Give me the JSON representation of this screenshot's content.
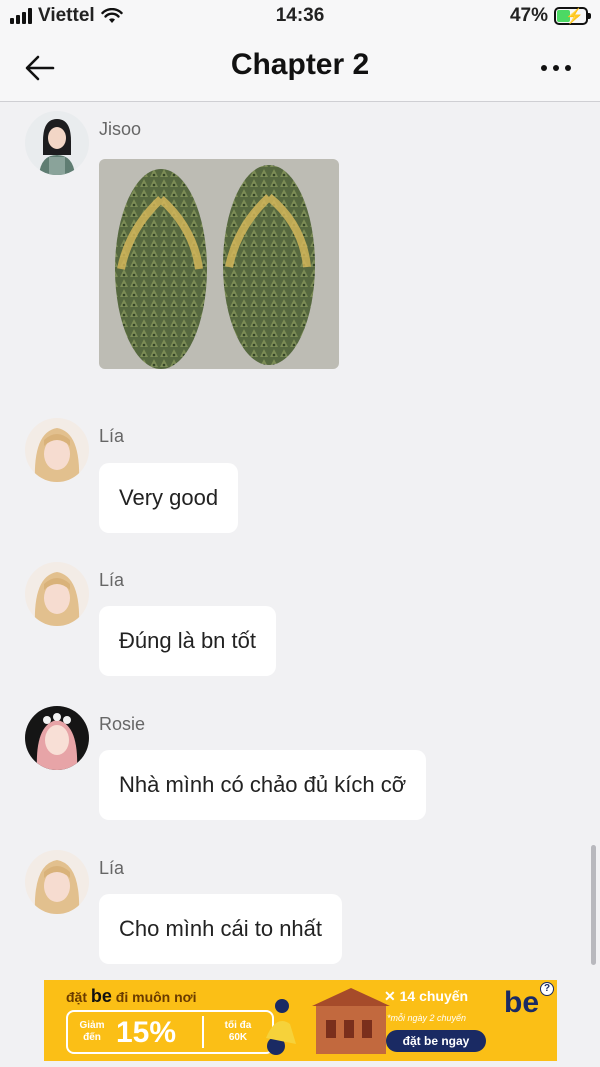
{
  "status_bar": {
    "carrier": "Viettel",
    "time": "14:36",
    "battery_percent_label": "47%",
    "battery_level": 0.47,
    "icons": [
      "signal-icon",
      "wifi-icon",
      "battery-charging-icon"
    ]
  },
  "nav": {
    "title": "Chapter 2",
    "icons": [
      "back-arrow-icon",
      "more-dots-icon"
    ]
  },
  "messages": [
    {
      "sender": "Jisoo",
      "type": "image",
      "image_subject": "durian-shell flip-flops"
    },
    {
      "sender": "Lía",
      "type": "text",
      "text": "Very good"
    },
    {
      "sender": "Lía",
      "type": "text",
      "text": "Đúng là bn tốt"
    },
    {
      "sender": "Rosie",
      "type": "text",
      "text": "Nhà mình có chảo đủ kích cỡ"
    },
    {
      "sender": "Lía",
      "type": "text",
      "text": "Cho mình cái to nhất"
    }
  ],
  "ad": {
    "headline_pre": "đặt",
    "headline_brand": "be",
    "headline_post": "đi muôn nơi",
    "promo_prefix_line1": "Giảm",
    "promo_prefix_line2": "đến",
    "promo_percent": "15%",
    "promo_suffix_line1": "tối đa",
    "promo_suffix_line2": "60K",
    "trips": "14 chuyến",
    "trips_note": "*mỗi ngày 2 chuyến",
    "cta": "đặt be ngay",
    "logo": "be",
    "help_icon": "?",
    "accent": "#fbbf16",
    "brand_color": "#1a2a63"
  }
}
